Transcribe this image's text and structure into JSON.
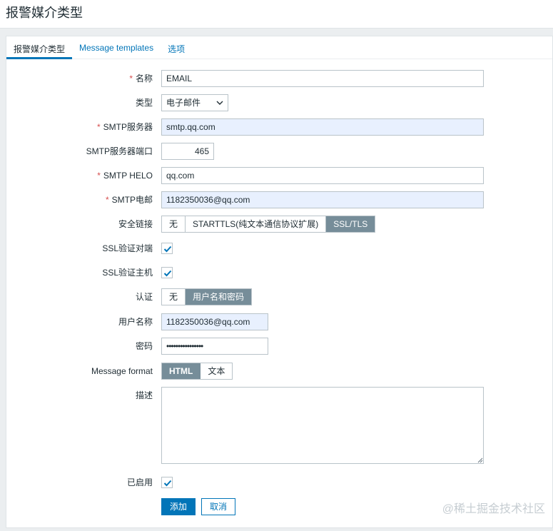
{
  "page": {
    "title": "报警媒介类型"
  },
  "tabs": [
    {
      "label": "报警媒介类型",
      "active": true
    },
    {
      "label": "Message templates",
      "active": false
    },
    {
      "label": "选项",
      "active": false
    }
  ],
  "form": {
    "name": {
      "label": "名称",
      "required": true,
      "value": "EMAIL"
    },
    "type": {
      "label": "类型",
      "value": "电子邮件"
    },
    "smtp_server": {
      "label": "SMTP服务器",
      "required": true,
      "value": "smtp.qq.com"
    },
    "smtp_port": {
      "label": "SMTP服务器端口",
      "value": "465"
    },
    "smtp_helo": {
      "label": "SMTP HELO",
      "required": true,
      "value": "qq.com"
    },
    "smtp_email": {
      "label": "SMTP电邮",
      "required": true,
      "value": "1182350036@qq.com"
    },
    "security": {
      "label": "安全链接",
      "options": [
        "无",
        "STARTTLS(纯文本通信协议扩展)",
        "SSL/TLS"
      ],
      "selected": "SSL/TLS"
    },
    "ssl_verify_peer": {
      "label": "SSL验证对端",
      "checked": true
    },
    "ssl_verify_host": {
      "label": "SSL验证主机",
      "checked": true
    },
    "auth": {
      "label": "认证",
      "options": [
        "无",
        "用户名和密码"
      ],
      "selected": "用户名和密码"
    },
    "username": {
      "label": "用户名称",
      "value": "1182350036@qq.com"
    },
    "password": {
      "label": "密码",
      "value": "••••••••••••••••"
    },
    "message_format": {
      "label": "Message format",
      "options": [
        "HTML",
        "文本"
      ],
      "selected": "HTML"
    },
    "description": {
      "label": "描述",
      "value": ""
    },
    "enabled": {
      "label": "已启用",
      "checked": true
    }
  },
  "buttons": {
    "add": "添加",
    "cancel": "取消"
  },
  "watermark": "@稀土掘金技术社区",
  "colors": {
    "accent": "#0275b8",
    "segment_selected": "#768d99",
    "required": "#d64e4e",
    "autofill": "#e8f0fe"
  }
}
